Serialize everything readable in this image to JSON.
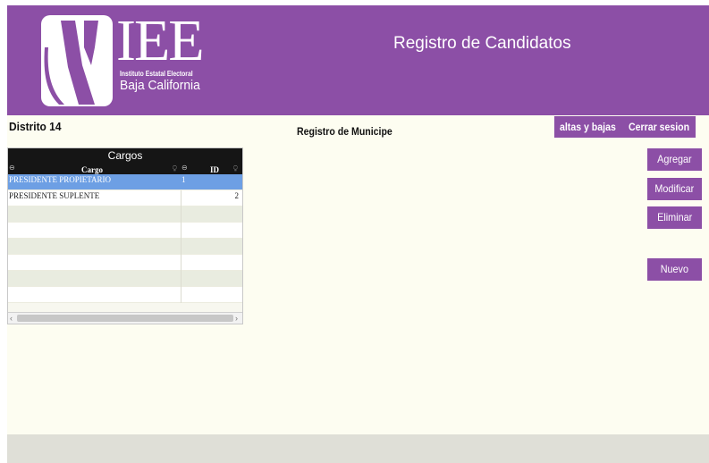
{
  "header": {
    "logo_letters": "IEE",
    "logo_line1": "Instituto Estatal Electoral",
    "logo_line2": "Baja California",
    "title": "Registro de Candidatos"
  },
  "district_label": "Distrito 14",
  "page_subtitle": "Registro de Municipe",
  "nav": {
    "altas_bajas": "altas y bajas",
    "cerrar_sesion": "Cerrar sesion"
  },
  "grid": {
    "caption": "Cargos",
    "columns": [
      "Cargo",
      "ID"
    ],
    "rows": [
      {
        "cargo": "PRESIDENTE PROPIETARIO",
        "id": "1",
        "selected": true
      },
      {
        "cargo": "PRESIDENTE SUPLENTE",
        "id": "2",
        "selected": false
      }
    ]
  },
  "actions": {
    "agregar": "Agregar",
    "modificar": "Modificar",
    "eliminar": "Eliminar",
    "nuevo": "Nuevo"
  },
  "colors": {
    "brand_purple": "#8c4fa6",
    "selection_blue": "#6d9fe4",
    "page_background": "#fdfdf1"
  }
}
